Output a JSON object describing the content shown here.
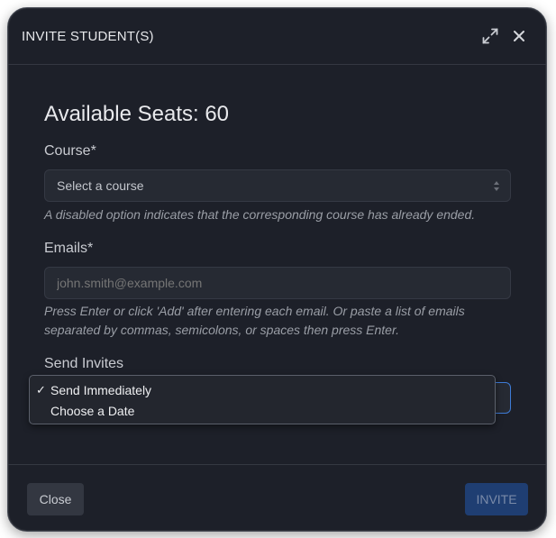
{
  "modal": {
    "title": "INVITE STUDENT(S)",
    "expand_icon": "expand-arrows-icon",
    "close_icon": "close-x-icon"
  },
  "seats": {
    "text": "Available Seats: 60"
  },
  "course": {
    "label": "Course*",
    "selected": "Select a course",
    "hint": "A disabled option indicates that the corresponding course has already ended."
  },
  "emails": {
    "label": "Emails*",
    "placeholder": "john.smith@example.com",
    "hint": "Press Enter or click 'Add' after entering each email. Or paste a list of emails separated by commas, semicolons, or spaces then press Enter."
  },
  "send_invites": {
    "label": "Send Invites",
    "options": [
      {
        "label": "Send Immediately",
        "checked": true
      },
      {
        "label": "Choose a Date",
        "checked": false
      }
    ],
    "check_mark": "✓"
  },
  "footer": {
    "close_label": "Close",
    "invite_label": "INVITE"
  },
  "colors": {
    "modal_bg": "#1d2029",
    "accent_focus": "#3e7bd6",
    "invite_bg": "#1f3e72"
  }
}
